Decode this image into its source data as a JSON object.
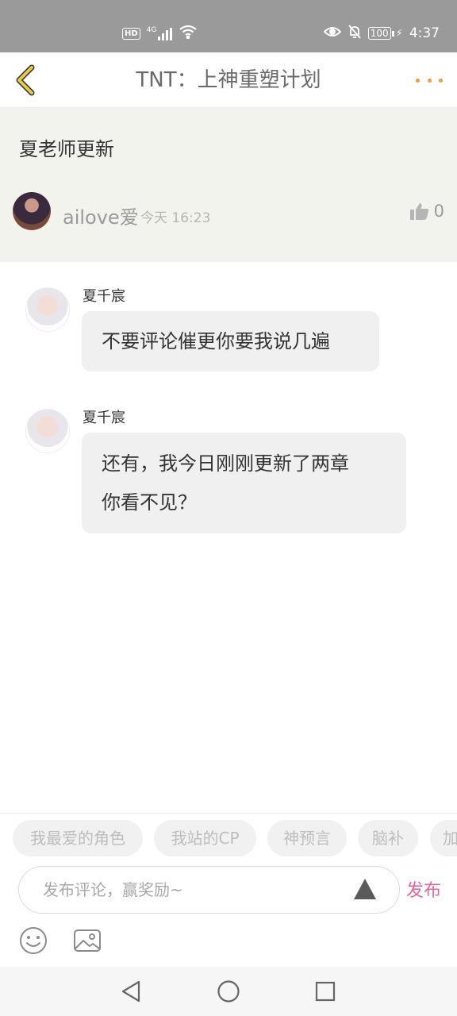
{
  "status_bar": {
    "hd": "HD",
    "network": "4G",
    "battery": "100",
    "time": "4:37"
  },
  "header": {
    "title": "TNT：上神重塑计划"
  },
  "post": {
    "text": "夏老师更新",
    "author": "ailove爱",
    "time": "今天 16:23",
    "likes": "0"
  },
  "messages": [
    {
      "sender": "夏千宸",
      "lines": [
        "不要评论催更你要我说几遍"
      ]
    },
    {
      "sender": "夏千宸",
      "lines": [
        "还有，我今日刚刚更新了两章",
        "你看不见？"
      ]
    }
  ],
  "tags": [
    "我最爱的角色",
    "我站的CP",
    "神预言",
    "脑补",
    "加"
  ],
  "comment": {
    "placeholder": "发布评论，赢奖励~",
    "publish_label": "发布"
  },
  "colors": {
    "accent_pink": "#e3669c",
    "back_yellow": "#e8c94a",
    "more_orange": "#f29a4a"
  }
}
